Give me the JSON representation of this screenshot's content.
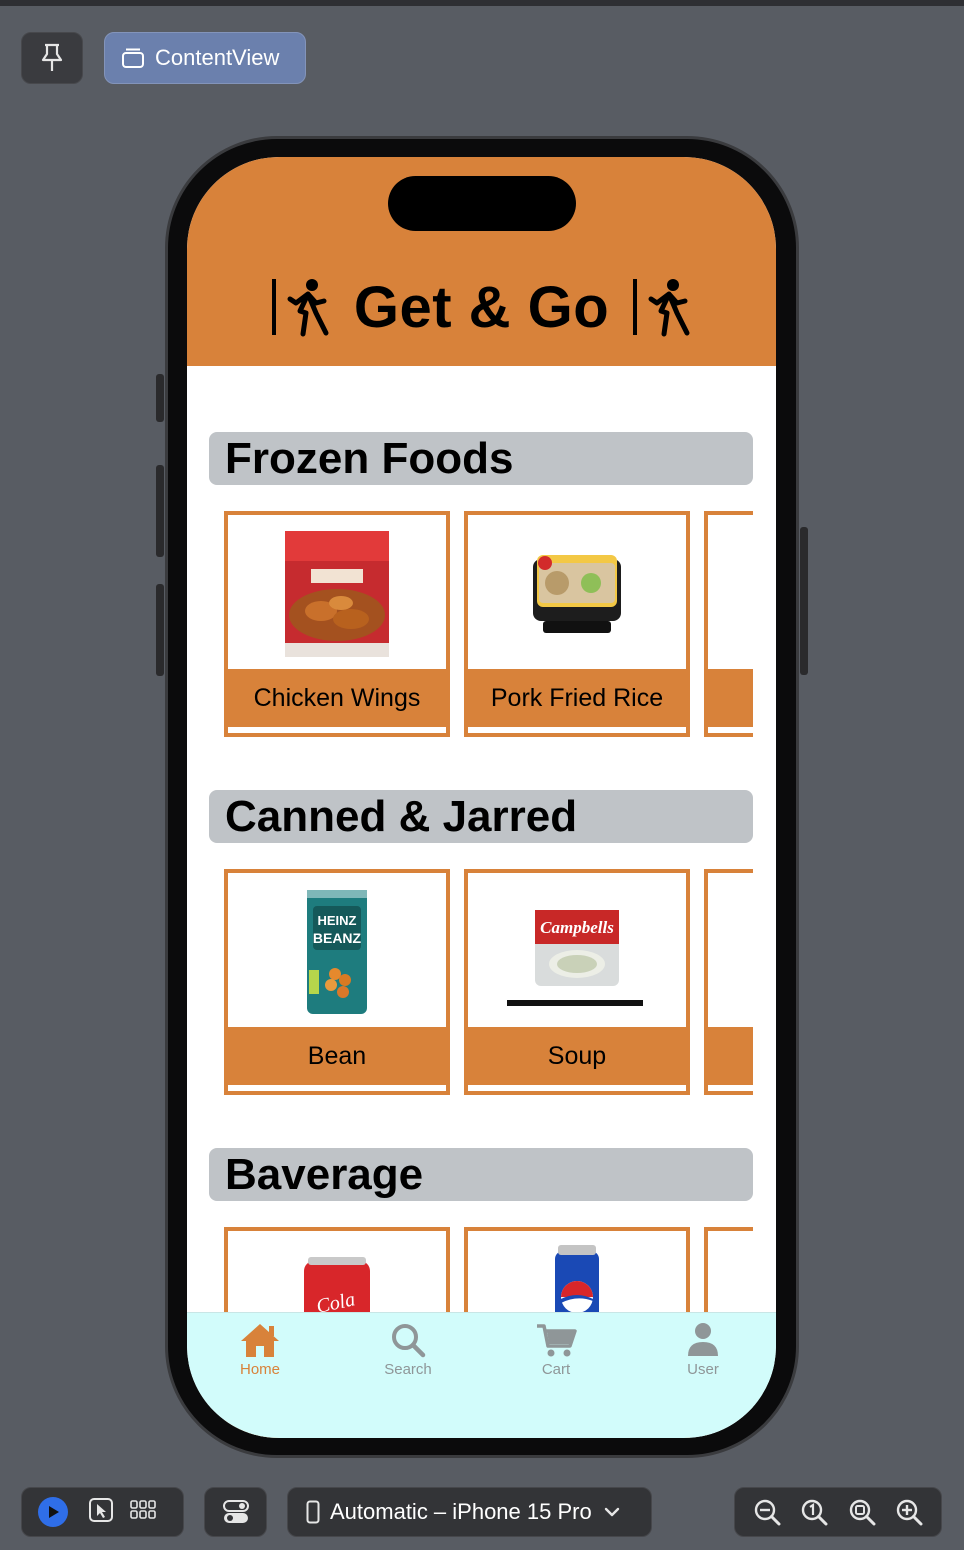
{
  "xcode": {
    "pin_icon": "pin-icon",
    "preview_button_label": "ContentView",
    "device_selector_label": "Automatic – iPhone 15 Pro",
    "canvas_modes": [
      "live-play-icon",
      "selectable-pointer-icon",
      "variants-grid-icon"
    ],
    "zoom_controls": [
      "zoom-out-icon",
      "zoom-actual-size-icon",
      "zoom-to-fit-icon",
      "zoom-in-icon"
    ]
  },
  "app": {
    "header_title": "Get & Go",
    "header_bg": "#d8823a",
    "accent": "#d8823a",
    "sections": [
      {
        "title": "Frozen Foods",
        "items": [
          {
            "name": "Chicken Wings",
            "image": "chicken-wings-image"
          },
          {
            "name": "Pork Fried Rice",
            "image": "pork-fried-rice-image"
          }
        ]
      },
      {
        "title": "Canned & Jarred",
        "items": [
          {
            "name": "Bean",
            "image": "heinz-beanz-can-image"
          },
          {
            "name": "Soup",
            "image": "campbells-soup-can-image"
          }
        ]
      },
      {
        "title": "Baverage",
        "items": [
          {
            "name": "",
            "image": "coca-cola-can-image"
          },
          {
            "name": "",
            "image": "pepsi-can-image"
          }
        ]
      }
    ],
    "tabbar": {
      "bg": "#d2fcfb",
      "tabs": [
        {
          "label": "Home",
          "icon": "house-icon",
          "active": true
        },
        {
          "label": "Search",
          "icon": "magnifier-icon",
          "active": false
        },
        {
          "label": "Cart",
          "icon": "cart-icon",
          "active": false
        },
        {
          "label": "User",
          "icon": "person-icon",
          "active": false
        }
      ]
    }
  }
}
